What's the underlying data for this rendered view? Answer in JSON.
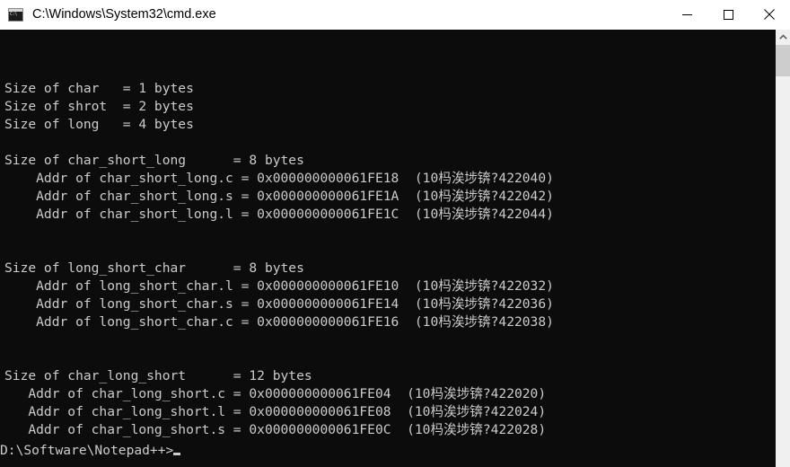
{
  "window": {
    "title": "C:\\Windows\\System32\\cmd.exe",
    "icon": "cmd-console-icon",
    "icon_glyph": "C:\\",
    "bg_color": "#0c0c0c",
    "text_color": "#cccccc",
    "titlebar_bg": "#ffffff"
  },
  "caption": {
    "minimize_label": "Minimize",
    "maximize_label": "Maximize",
    "close_label": "Close"
  },
  "scrollbar": {
    "up_arrow_label": "Scroll up",
    "thumb_label": "Scroll thumb"
  },
  "console": {
    "lines": [
      "Size of char   = 1 bytes",
      "Size of shrot  = 2 bytes",
      "Size of long   = 4 bytes",
      "",
      "Size of char_short_long      = 8 bytes",
      "    Addr of char_short_long.c = 0x000000000061FE18  (10杩涘埗锛?422040)",
      "    Addr of char_short_long.s = 0x000000000061FE1A  (10杩涘埗锛?422042)",
      "    Addr of char_short_long.l = 0x000000000061FE1C  (10杩涘埗锛?422044)",
      "",
      "",
      "Size of long_short_char      = 8 bytes",
      "    Addr of long_short_char.l = 0x000000000061FE10  (10杩涘埗锛?422032)",
      "    Addr of long_short_char.s = 0x000000000061FE14  (10杩涘埗锛?422036)",
      "    Addr of long_short_char.c = 0x000000000061FE16  (10杩涘埗锛?422038)",
      "",
      "",
      "Size of char_long_short      = 12 bytes",
      "   Addr of char_long_short.c = 0x000000000061FE04  (10杩涘埗锛?422020)",
      "   Addr of char_long_short.l = 0x000000000061FE08  (10杩涘埗锛?422024)",
      "   Addr of char_long_short.s = 0x000000000061FE0C  (10杩涘埗锛?422028)"
    ],
    "prompt": "D:\\Software\\Notepad++>"
  }
}
